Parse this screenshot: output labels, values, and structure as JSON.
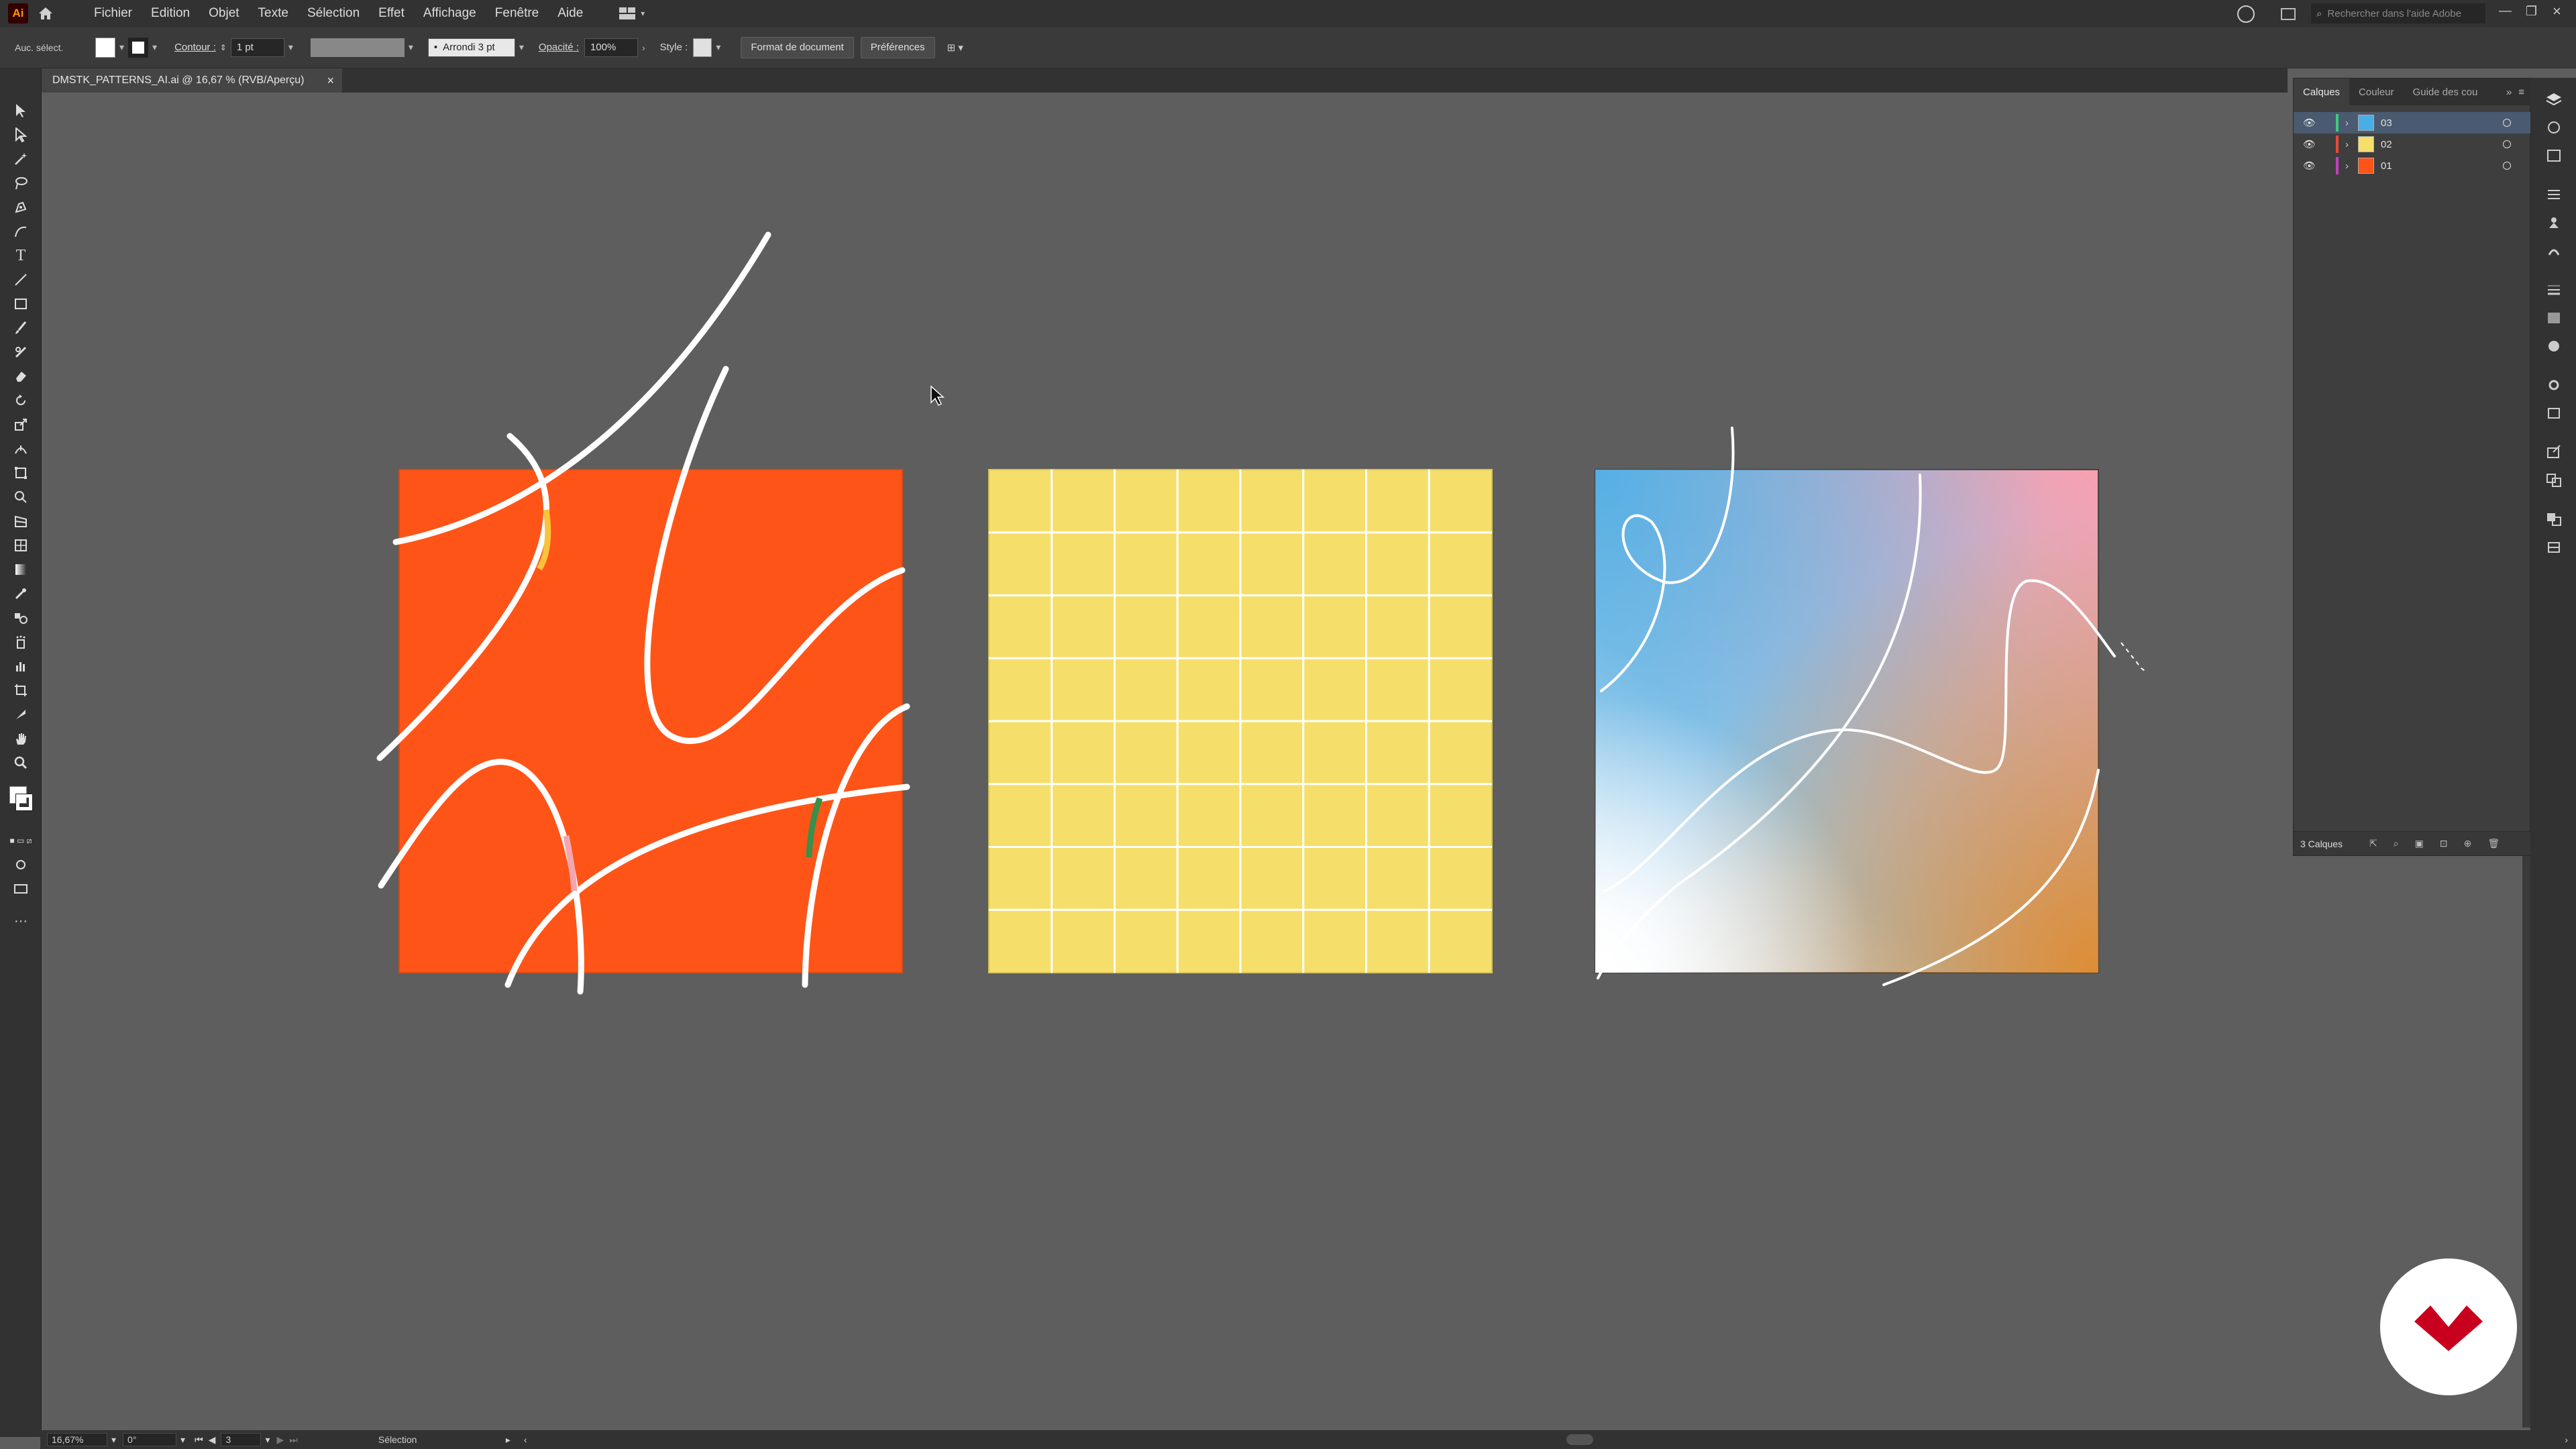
{
  "app": {
    "logo_text": "Ai"
  },
  "menubar": {
    "items": [
      "Fichier",
      "Edition",
      "Objet",
      "Texte",
      "Sélection",
      "Effet",
      "Affichage",
      "Fenêtre",
      "Aide"
    ],
    "search_placeholder": "Rechercher dans l'aide Adobe"
  },
  "controlbar": {
    "selection_label": "Auc. sélect.",
    "stroke_label": "Contour :",
    "stroke_value": "1 pt",
    "brush_label": "Arrondi 3 pt",
    "opacity_label": "Opacité :",
    "opacity_value": "100%",
    "style_label": "Style :",
    "doc_setup_button": "Format de document",
    "preferences_button": "Préférences"
  },
  "document": {
    "tab_title": "DMSTK_PATTERNS_AI.ai @ 16,67 % (RVB/Aperçu)",
    "close_glyph": "×"
  },
  "artboards": {
    "orange_color": "#ff5418",
    "yellow_color": "#f5df6a",
    "gradient_colors": [
      "#4aaee6",
      "#f4a0ac",
      "#e08e35",
      "#ffffff"
    ],
    "grid_columns": 8,
    "grid_rows": 8
  },
  "layers_panel": {
    "tabs": [
      "Calques",
      "Couleur",
      "Guide des cou"
    ],
    "layers": [
      {
        "name": "03",
        "color": "#41c882",
        "selected": true,
        "thumb": "#4aaee6"
      },
      {
        "name": "02",
        "color": "#e84a3c",
        "selected": false,
        "thumb": "#f5df6a"
      },
      {
        "name": "01",
        "color": "#c040c0",
        "selected": false,
        "thumb": "#ff5418"
      }
    ],
    "footer_count": "3 Calques"
  },
  "statusbar": {
    "zoom": "16,67%",
    "rotation": "0°",
    "artboard_number": "3",
    "tool_name": "Sélection"
  }
}
